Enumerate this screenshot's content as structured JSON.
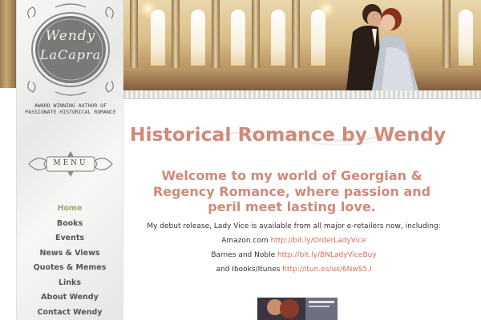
{
  "logo": {
    "line1": "Wendy",
    "line2": "LaCapra"
  },
  "tagline": "AWARD WINNING AUTHOR OF PASSIONATE HISTORICAL ROMANCE",
  "menu_label": "MENU",
  "nav": {
    "active": "Home",
    "items": [
      {
        "label": "Home"
      },
      {
        "label": "Books"
      },
      {
        "label": "Events"
      },
      {
        "label": "News & Views"
      },
      {
        "label": "Quotes & Memes"
      },
      {
        "label": "Links"
      },
      {
        "label": "About Wendy"
      },
      {
        "label": "Contact Wendy"
      }
    ]
  },
  "main": {
    "title": "Historical Romance by Wendy",
    "welcome": "Welcome to my world of Georgian & Regency Romance, where passion and peril meet lasting love.",
    "intro": "My debut release, Lady Vice is available from all major e-retailers now, including:",
    "retailers": [
      {
        "name": "Amazon.com",
        "link": "http://bit.ly/OrderLadyVice"
      },
      {
        "name": "Barnes and Noble",
        "link": "http://bit.ly/BNLadyViceBuy"
      },
      {
        "name": "and Ibooks/Itunes",
        "link": "http://itun.es/us/6NwS5.l"
      }
    ]
  },
  "colors": {
    "accent": "#cf8a78",
    "link": "#d07058",
    "nav_active": "#a7a16e",
    "nav_text": "#555555",
    "sidebar_bg": "#efefed"
  }
}
